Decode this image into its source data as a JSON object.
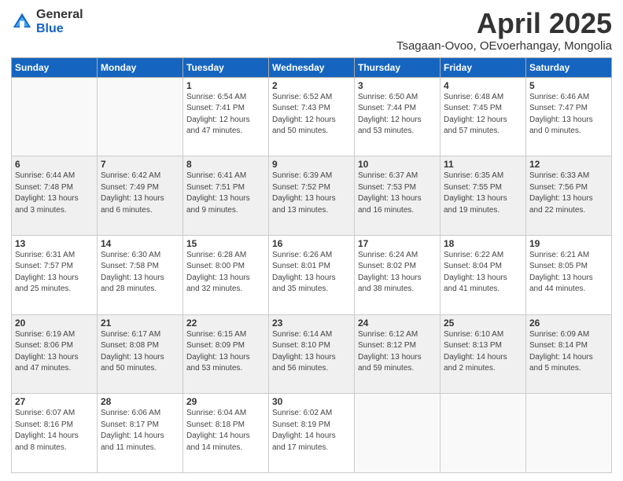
{
  "logo": {
    "general": "General",
    "blue": "Blue"
  },
  "header": {
    "title": "April 2025",
    "subtitle": "Tsagaan-Ovoo, OEvoerhangay, Mongolia"
  },
  "weekdays": [
    "Sunday",
    "Monday",
    "Tuesday",
    "Wednesday",
    "Thursday",
    "Friday",
    "Saturday"
  ],
  "weeks": [
    [
      {
        "day": "",
        "info": ""
      },
      {
        "day": "",
        "info": ""
      },
      {
        "day": "1",
        "info": "Sunrise: 6:54 AM\nSunset: 7:41 PM\nDaylight: 12 hours and 47 minutes."
      },
      {
        "day": "2",
        "info": "Sunrise: 6:52 AM\nSunset: 7:43 PM\nDaylight: 12 hours and 50 minutes."
      },
      {
        "day": "3",
        "info": "Sunrise: 6:50 AM\nSunset: 7:44 PM\nDaylight: 12 hours and 53 minutes."
      },
      {
        "day": "4",
        "info": "Sunrise: 6:48 AM\nSunset: 7:45 PM\nDaylight: 12 hours and 57 minutes."
      },
      {
        "day": "5",
        "info": "Sunrise: 6:46 AM\nSunset: 7:47 PM\nDaylight: 13 hours and 0 minutes."
      }
    ],
    [
      {
        "day": "6",
        "info": "Sunrise: 6:44 AM\nSunset: 7:48 PM\nDaylight: 13 hours and 3 minutes."
      },
      {
        "day": "7",
        "info": "Sunrise: 6:42 AM\nSunset: 7:49 PM\nDaylight: 13 hours and 6 minutes."
      },
      {
        "day": "8",
        "info": "Sunrise: 6:41 AM\nSunset: 7:51 PM\nDaylight: 13 hours and 9 minutes."
      },
      {
        "day": "9",
        "info": "Sunrise: 6:39 AM\nSunset: 7:52 PM\nDaylight: 13 hours and 13 minutes."
      },
      {
        "day": "10",
        "info": "Sunrise: 6:37 AM\nSunset: 7:53 PM\nDaylight: 13 hours and 16 minutes."
      },
      {
        "day": "11",
        "info": "Sunrise: 6:35 AM\nSunset: 7:55 PM\nDaylight: 13 hours and 19 minutes."
      },
      {
        "day": "12",
        "info": "Sunrise: 6:33 AM\nSunset: 7:56 PM\nDaylight: 13 hours and 22 minutes."
      }
    ],
    [
      {
        "day": "13",
        "info": "Sunrise: 6:31 AM\nSunset: 7:57 PM\nDaylight: 13 hours and 25 minutes."
      },
      {
        "day": "14",
        "info": "Sunrise: 6:30 AM\nSunset: 7:58 PM\nDaylight: 13 hours and 28 minutes."
      },
      {
        "day": "15",
        "info": "Sunrise: 6:28 AM\nSunset: 8:00 PM\nDaylight: 13 hours and 32 minutes."
      },
      {
        "day": "16",
        "info": "Sunrise: 6:26 AM\nSunset: 8:01 PM\nDaylight: 13 hours and 35 minutes."
      },
      {
        "day": "17",
        "info": "Sunrise: 6:24 AM\nSunset: 8:02 PM\nDaylight: 13 hours and 38 minutes."
      },
      {
        "day": "18",
        "info": "Sunrise: 6:22 AM\nSunset: 8:04 PM\nDaylight: 13 hours and 41 minutes."
      },
      {
        "day": "19",
        "info": "Sunrise: 6:21 AM\nSunset: 8:05 PM\nDaylight: 13 hours and 44 minutes."
      }
    ],
    [
      {
        "day": "20",
        "info": "Sunrise: 6:19 AM\nSunset: 8:06 PM\nDaylight: 13 hours and 47 minutes."
      },
      {
        "day": "21",
        "info": "Sunrise: 6:17 AM\nSunset: 8:08 PM\nDaylight: 13 hours and 50 minutes."
      },
      {
        "day": "22",
        "info": "Sunrise: 6:15 AM\nSunset: 8:09 PM\nDaylight: 13 hours and 53 minutes."
      },
      {
        "day": "23",
        "info": "Sunrise: 6:14 AM\nSunset: 8:10 PM\nDaylight: 13 hours and 56 minutes."
      },
      {
        "day": "24",
        "info": "Sunrise: 6:12 AM\nSunset: 8:12 PM\nDaylight: 13 hours and 59 minutes."
      },
      {
        "day": "25",
        "info": "Sunrise: 6:10 AM\nSunset: 8:13 PM\nDaylight: 14 hours and 2 minutes."
      },
      {
        "day": "26",
        "info": "Sunrise: 6:09 AM\nSunset: 8:14 PM\nDaylight: 14 hours and 5 minutes."
      }
    ],
    [
      {
        "day": "27",
        "info": "Sunrise: 6:07 AM\nSunset: 8:16 PM\nDaylight: 14 hours and 8 minutes."
      },
      {
        "day": "28",
        "info": "Sunrise: 6:06 AM\nSunset: 8:17 PM\nDaylight: 14 hours and 11 minutes."
      },
      {
        "day": "29",
        "info": "Sunrise: 6:04 AM\nSunset: 8:18 PM\nDaylight: 14 hours and 14 minutes."
      },
      {
        "day": "30",
        "info": "Sunrise: 6:02 AM\nSunset: 8:19 PM\nDaylight: 14 hours and 17 minutes."
      },
      {
        "day": "",
        "info": ""
      },
      {
        "day": "",
        "info": ""
      },
      {
        "day": "",
        "info": ""
      }
    ]
  ]
}
